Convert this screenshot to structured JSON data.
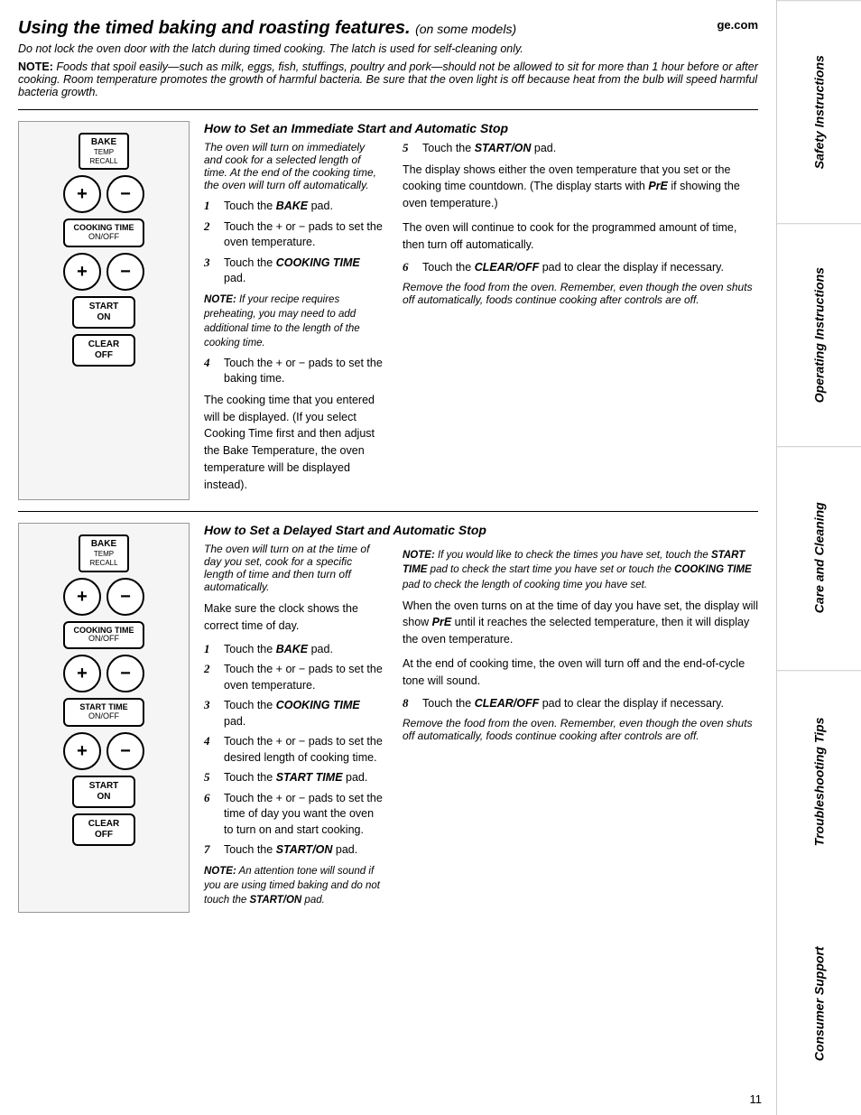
{
  "sidebar": {
    "sections": [
      "Safety Instructions",
      "Operating Instructions",
      "Care and Cleaning",
      "Troubleshooting Tips",
      "Consumer Support"
    ]
  },
  "header": {
    "title": "Using the timed baking and roasting features.",
    "subtitle": "(on some models)",
    "website": "ge.com"
  },
  "intro": {
    "warning": "Do not lock the oven door with the latch during timed cooking. The latch is used for self-cleaning only.",
    "note_label": "NOTE:",
    "note_text": "Foods that spoil easily—such as milk, eggs, fish, stuffings, poultry and pork—should not be allowed to sit for more than 1 hour before or after cooking. Room temperature promotes the growth of harmful bacteria. Be sure that the oven light is off because heat from the bulb will speed harmful bacteria growth."
  },
  "section1": {
    "heading": "How to Set an Immediate Start and Automatic Stop",
    "intro": "The oven will turn on immediately and cook for a selected length of time. At the end of the cooking time, the oven will turn off automatically.",
    "steps_left": [
      {
        "num": "1",
        "text": "Touch the ",
        "bold": "BAKE",
        "after": " pad."
      },
      {
        "num": "2",
        "text": "Touch the + or − pads to set the oven temperature."
      },
      {
        "num": "3",
        "text": "Touch the ",
        "bold": "COOKING TIME",
        "after": " pad."
      }
    ],
    "note_middle": "NOTE: If your recipe requires preheating, you may need to add additional time to the length of the cooking time.",
    "step4": {
      "num": "4",
      "text": "Touch the + or − pads to set the baking time."
    },
    "body1": "The cooking time that you entered will be displayed. (If you select Cooking Time first and then adjust the Bake Temperature, the oven temperature will be displayed instead).",
    "steps_right": [
      {
        "num": "5",
        "text": "Touch the ",
        "bold": "START/ON",
        "after": " pad."
      }
    ],
    "body_right1": "The display shows either the oven temperature that you set or the cooking time countdown. (The display starts with PrE if showing the oven temperature.)",
    "body_right2": "The oven will continue to cook for the programmed amount of time, then turn off automatically.",
    "step6": {
      "num": "6",
      "text": "Touch the ",
      "bold": "CLEAR/OFF",
      "after": " pad to clear the display if necessary."
    },
    "footer_italic": "Remove the food from the oven. Remember, even though the oven shuts off automatically, foods continue cooking after controls are off.",
    "controls": {
      "bake": "BAKE",
      "bake_sub1": "TEMP",
      "bake_sub2": "RECALL",
      "cooking_time": "COOKING TIME",
      "cooking_sub": "ON/OFF",
      "start": "START",
      "start2": "ON",
      "clear": "CLEAR",
      "clear2": "OFF"
    }
  },
  "section2": {
    "heading": "How to Set a Delayed Start and Automatic Stop",
    "intro": "The oven will turn on at the time of day you set, cook for a specific length of time and then turn off automatically.",
    "lead": "Make sure the clock shows the correct time of day.",
    "steps_left": [
      {
        "num": "1",
        "text": "Touch the ",
        "bold": "BAKE",
        "after": " pad."
      },
      {
        "num": "2",
        "text": "Touch the + or − pads to set the oven temperature."
      },
      {
        "num": "3",
        "text": "Touch the ",
        "bold": "COOKING TIME",
        "after": " pad."
      },
      {
        "num": "4",
        "text": "Touch the + or − pads to set the desired length of cooking time."
      },
      {
        "num": "5",
        "text": "Touch the ",
        "bold": "START TIME",
        "after": " pad."
      },
      {
        "num": "6",
        "text": "Touch the + or − pads to set the time of day you want the oven to turn on and start cooking."
      },
      {
        "num": "7",
        "text": "Touch the ",
        "bold": "START/ON",
        "after": " pad."
      }
    ],
    "note_bottom": "NOTE: An attention tone will sound if you are using timed baking and do not touch the START/ON pad.",
    "note_right": "NOTE: If you would like to check the times you have set, touch the START TIME pad to check the start time you have set or touch the COOKING TIME pad to check the length of cooking time you have set.",
    "body_right1": "When the oven turns on at the time of day you have set, the display will show PrE until it reaches the selected temperature, then it will display the oven temperature.",
    "body_right2": "At the end of cooking time, the oven will turn off and the end-of-cycle tone will sound.",
    "step8": {
      "num": "8",
      "text": "Touch the ",
      "bold": "CLEAR/OFF",
      "after": " pad to clear the display if necessary."
    },
    "footer_italic": "Remove the food from the oven. Remember, even though the oven shuts off automatically, foods continue cooking after controls are off.",
    "controls": {
      "bake": "BAKE",
      "bake_sub1": "TEMP",
      "bake_sub2": "RECALL",
      "cooking_time": "COOKING TIME",
      "cooking_sub": "ON/OFF",
      "start_time": "START TIME",
      "start_time_sub": "ON/OFF",
      "start": "START",
      "start2": "ON",
      "clear": "CLEAR",
      "clear2": "OFF"
    }
  },
  "page_number": "11"
}
